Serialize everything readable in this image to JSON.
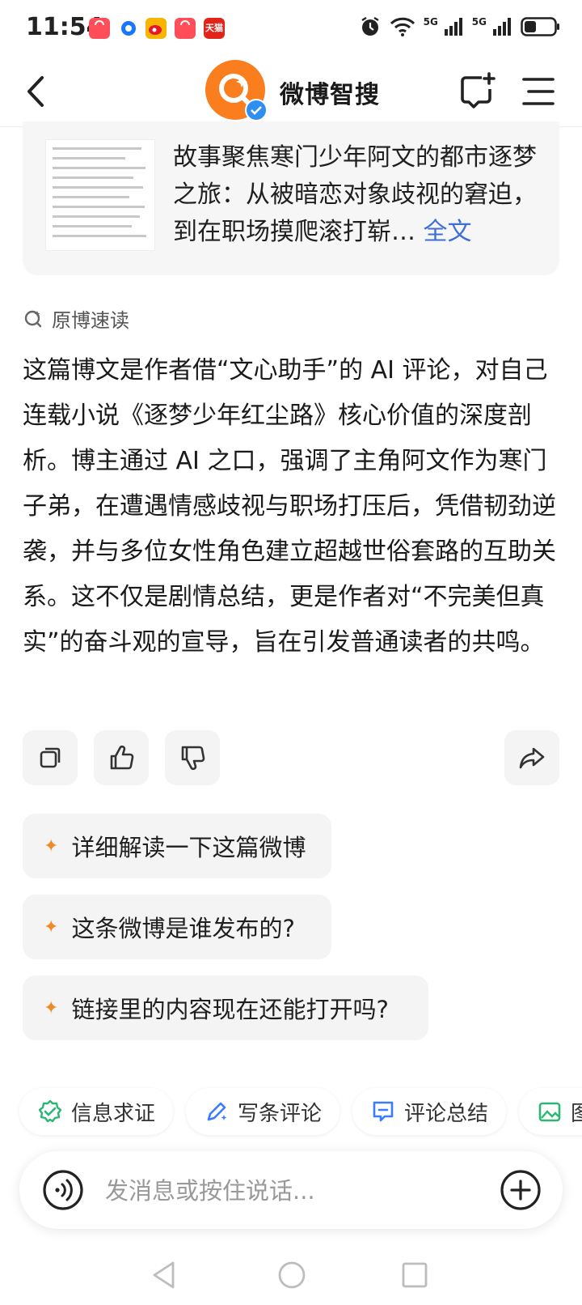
{
  "status_bar": {
    "time": "11:54",
    "app_icons": [
      {
        "name": "shopping-bag-icon",
        "color": "#ff4d5a"
      },
      {
        "name": "ctrip-icon",
        "color": "#1677ff"
      },
      {
        "name": "weibo-icon",
        "color": "#f7b500"
      },
      {
        "name": "shopping-bag-icon",
        "color": "#ff4d5a"
      },
      {
        "name": "tmall-icon",
        "color": "#e2231a",
        "label": "天猫"
      }
    ],
    "signal_labels": [
      "5G",
      "5G"
    ]
  },
  "header": {
    "title": "微博智搜",
    "back_icon": "chevron-left-icon",
    "new_chat_icon": "new-chat-icon",
    "menu_icon": "menu-icon"
  },
  "source_card": {
    "text": "故事聚焦寒门少年阿文的都市逐梦之旅：从被暗恋对象歧视的窘迫，到在职场摸爬滚打崭…",
    "more_label": "全文"
  },
  "summary": {
    "heading": "原博速读",
    "text": "这篇博文是作者借“文心助手”的 AI 评论，对自己连载小说《逐梦少年红尘路》核心价值的深度剖析。博主通过 AI 之口，强调了主角阿文作为寒门子弟，在遭遇情感歧视与职场打压后，凭借韧劲逆袭，并与多位女性角色建立超越世俗套路的互助关系。这不仅是剧情总结，更是作者对“不完美但真实”的奋斗观的宣导，旨在引发普通读者的共鸣。"
  },
  "actions": [
    {
      "name": "copy-icon"
    },
    {
      "name": "thumbs-up-icon"
    },
    {
      "name": "thumbs-down-icon"
    },
    {
      "name": "share-icon"
    }
  ],
  "suggestions": [
    {
      "label": "详细解读一下这篇微博"
    },
    {
      "label": "这条微博是谁发布的?"
    },
    {
      "label": "链接里的内容现在还能打开吗?"
    }
  ],
  "tools": [
    {
      "label": "信息求证",
      "icon": "verify-icon",
      "color": "#2bb673"
    },
    {
      "label": "写条评论",
      "icon": "pen-icon",
      "color": "#3a7bff"
    },
    {
      "label": "评论总结",
      "icon": "comment-summary-icon",
      "color": "#3a7bff"
    },
    {
      "label": "图",
      "icon": "image-icon",
      "color": "#2bb673"
    }
  ],
  "input": {
    "placeholder": "发消息或按住说话..."
  },
  "colors": {
    "accent": "#fa7d1e",
    "link": "#3f6fd6",
    "verified": "#2f8ff0",
    "sparkle": "#f08a24"
  }
}
